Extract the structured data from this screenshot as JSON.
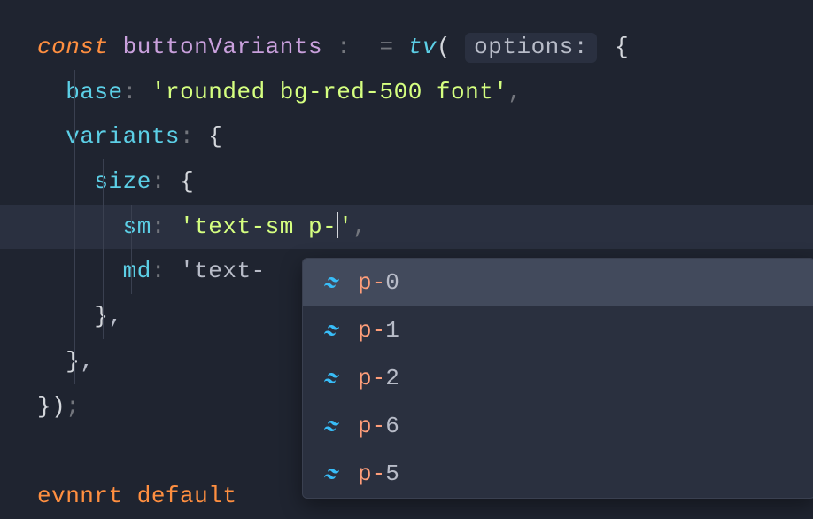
{
  "code": {
    "line1": {
      "keyword": "const",
      "varName": "buttonVariants",
      "func": "tv",
      "hint": "options:"
    },
    "line2": {
      "prop": "base",
      "value": "'rounded bg-red-500 font'"
    },
    "line3": {
      "prop": "variants"
    },
    "line4": {
      "prop": "size"
    },
    "line5": {
      "prop": "sm",
      "value_pre": "'text-sm p-",
      "value_post": "'"
    },
    "line6": {
      "prop": "md",
      "value": "'text-"
    },
    "line10": {
      "partial": "evnnrt default"
    }
  },
  "autocomplete": {
    "items": [
      {
        "match": "p-",
        "rest": "0"
      },
      {
        "match": "p-",
        "rest": "1"
      },
      {
        "match": "p-",
        "rest": "2"
      },
      {
        "match": "p-",
        "rest": "6"
      },
      {
        "match": "p-",
        "rest": "5"
      }
    ]
  }
}
